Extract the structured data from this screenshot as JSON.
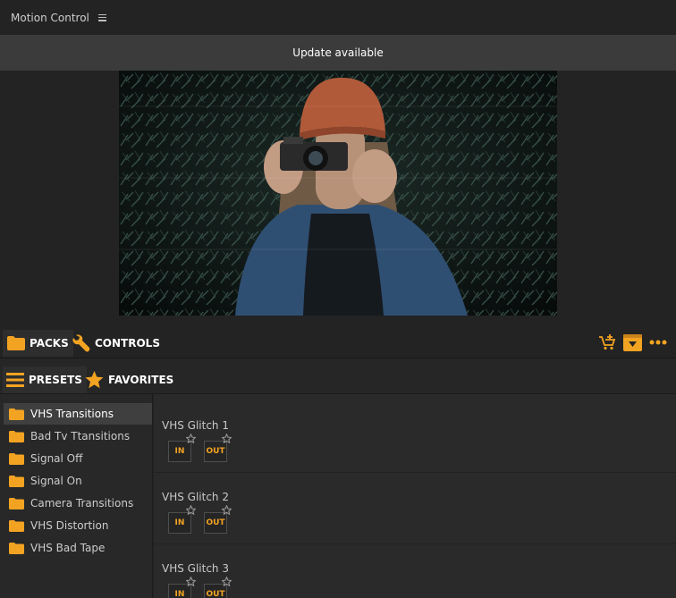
{
  "app": {
    "title": "Motion Control"
  },
  "update_banner": {
    "text": "Update available"
  },
  "toolbar": {
    "tabs": [
      {
        "label": "PACKS",
        "icon": "folder-icon"
      },
      {
        "label": "CONTROLS",
        "icon": "wrench-icon"
      }
    ],
    "actions": [
      {
        "icon": "add-to-cart-icon"
      },
      {
        "icon": "download-box-icon"
      },
      {
        "icon": "more-icon"
      }
    ]
  },
  "subtabs": [
    {
      "label": "PRESETS",
      "icon": "list-icon"
    },
    {
      "label": "FAVORITES",
      "icon": "star-icon"
    }
  ],
  "sidebar": {
    "items": [
      {
        "label": "VHS Transitions",
        "selected": true
      },
      {
        "label": "Bad Tv Ttansitions"
      },
      {
        "label": "Signal Off"
      },
      {
        "label": "Signal On"
      },
      {
        "label": "Camera Transitions"
      },
      {
        "label": "VHS Distortion"
      },
      {
        "label": "VHS Bad Tape"
      }
    ]
  },
  "presets": [
    {
      "name": "VHS Glitch 1",
      "in_label": "IN",
      "out_label": "OUT"
    },
    {
      "name": "VHS Glitch 2",
      "in_label": "IN",
      "out_label": "OUT"
    },
    {
      "name": "VHS Glitch 3",
      "in_label": "IN",
      "out_label": "OUT"
    }
  ],
  "colors": {
    "accent": "#f3a322",
    "background": "#232323",
    "banner": "#3b3b3b",
    "selected_item": "#3f3f3f"
  }
}
